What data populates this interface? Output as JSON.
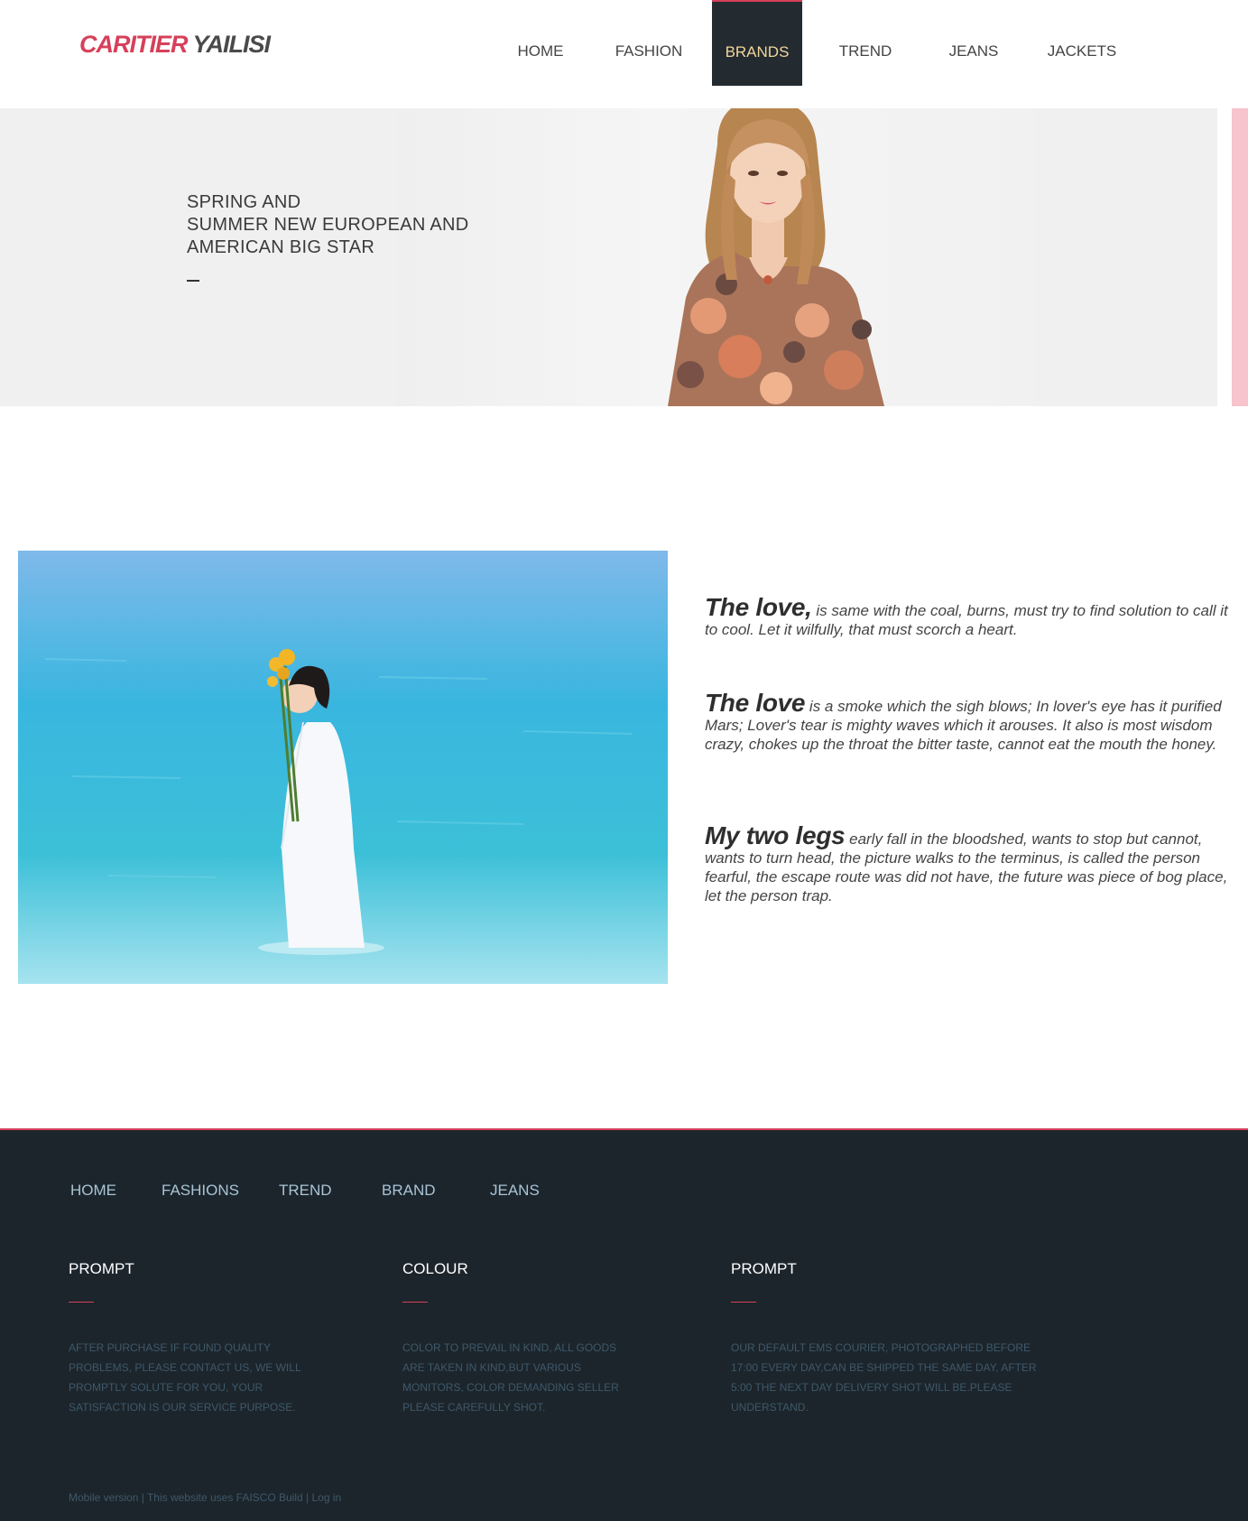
{
  "header": {
    "logo_part1": "CARITIER",
    "logo_part2": "YAILISI",
    "nav": [
      "HOME",
      "FASHION",
      "BRANDS",
      "TREND",
      "JEANS",
      "JACKETS"
    ],
    "active_nav": "BRANDS"
  },
  "banner": {
    "line1": "SPRING AND",
    "line2": "SUMMER NEW EUROPEAN AND",
    "line3": "AMERICAN BIG STAR"
  },
  "content": {
    "p1_lead": "The love,",
    "p1_text": " is same with the coal, burns, must try to find solution to call it to cool. Let it wilfully, that must scorch a heart.",
    "p2_lead": "The love",
    "p2_text": " is a smoke which the sigh blows; In lover's eye has it purified Mars; Lover's tear is mighty waves which it arouses. It also is most wisdom crazy, chokes up the throat the bitter taste, cannot eat the mouth the honey.",
    "p3_lead": "My two legs",
    "p3_text": " early fall in the bloodshed, wants to stop but cannot, wants to turn head, the picture walks to the terminus, is called the person fearful, the escape route was did not have, the future was piece of bog place, let the person trap."
  },
  "footer": {
    "nav": [
      "HOME",
      "FASHIONS",
      "TREND",
      "BRAND",
      "JEANS"
    ],
    "col1_title": "PROMPT",
    "col1_text": "AFTER PURCHASE IF FOUND QUALITY PROBLEMS, PLEASE CONTACT US, WE WILL PROMPTLY SOLUTE FOR YOU, YOUR SATISFACTION IS OUR SERVICE PURPOSE.",
    "col2_title": "COLOUR",
    "col2_text": "COLOR TO PREVAIL IN KIND, ALL GOODS ARE TAKEN IN KIND,BUT VARIOUS MONITORS, COLOR DEMANDING SELLER PLEASE CAREFULLY SHOT.",
    "col3_title": "PROMPT",
    "col3_text": "OUR DEFAULT EMS COURIER, PHOTOGRAPHED BEFORE 17:00 EVERY DAY,CAN BE SHIPPED THE SAME DAY, AFTER 5:00 THE NEXT DAY DELIVERY SHOT WILL BE.PLEASE UNDERSTAND.",
    "bottom_mobile": "Mobile version",
    "bottom_sep1": " | ",
    "bottom_faisco": "This website uses FAISCO Build",
    "bottom_sep2": " | ",
    "bottom_login": "Log in"
  },
  "colors": {
    "accent": "#d6405a",
    "nav_active_bg": "#232a30",
    "nav_active_text": "#f0d79a",
    "footer_bg": "#1c252c"
  }
}
